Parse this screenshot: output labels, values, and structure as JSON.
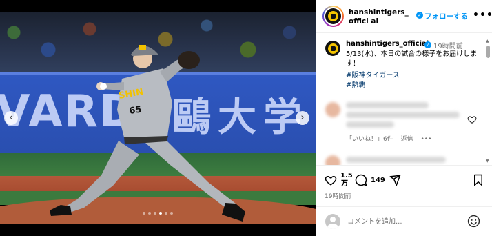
{
  "post": {
    "username": "hanshintigers_official",
    "head_username": "hanshintigers_offici al",
    "follow_label": "フォローする",
    "more_label": "•••",
    "time_ago": "19時間前",
    "caption": "5/13(水)、本日の試合の様子をお届けします！",
    "hashtags": [
      "#阪神タイガース",
      "#熱覇"
    ]
  },
  "media": {
    "banner_left_text": "VARD",
    "banner_right_text": "鷗大学",
    "jersey_text": "SHIN",
    "jersey_number": "65",
    "prev_label": "‹",
    "next_label": "›",
    "slide_count": 6,
    "active_slide": 4
  },
  "comment": {
    "likes_label": "「いいね！」6件",
    "reply_label": "返信",
    "more_label": "•••"
  },
  "actions": {
    "like_count": "1.5万",
    "like_count_line1": "1.5",
    "like_count_line2": "万",
    "comment_count": "149",
    "posted": "19時間前"
  },
  "composer": {
    "placeholder": "コメントを追加..."
  },
  "colors": {
    "accent": "#0095f6",
    "hashtag": "#00376b",
    "muted": "#737373"
  }
}
